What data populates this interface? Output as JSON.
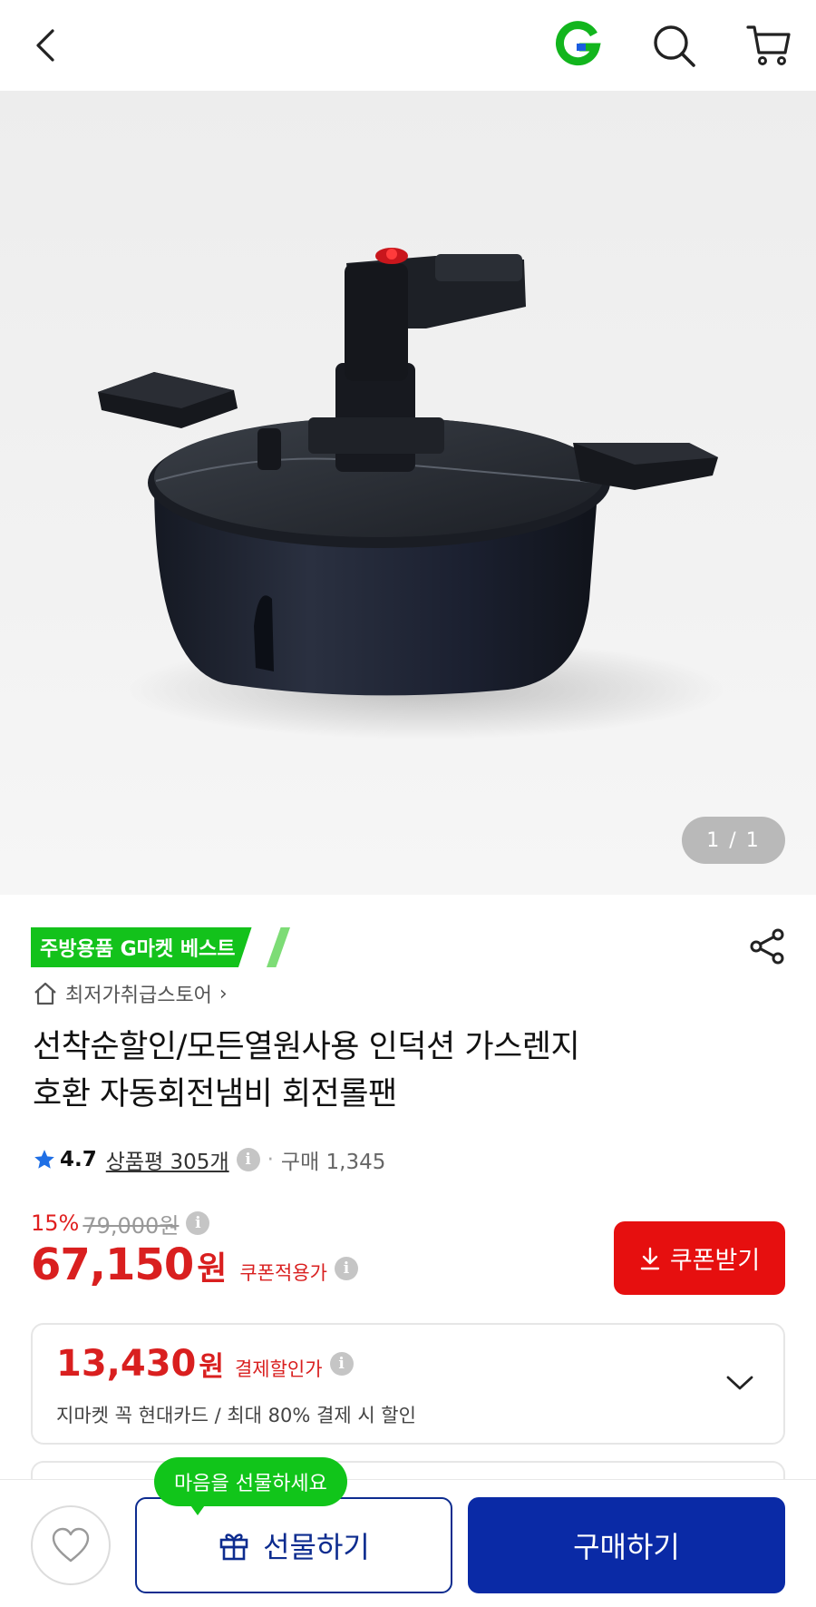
{
  "header": {
    "back_icon": "chevron-left-icon",
    "logo_letter": "G",
    "logo_color": "#12b51d",
    "search_icon": "search-icon",
    "cart_icon": "cart-icon"
  },
  "gallery": {
    "counter": "1 / 1"
  },
  "product": {
    "badge": "주방용품 G마켓 베스트",
    "badge_color": "#13c21b",
    "store_name": "최저가취급스토어",
    "title_line1": "선착순할인/모든열원사용 인덕션 가스렌지",
    "title_line2": "호환 자동회전냄비 회전롤팬",
    "rating": "4.7",
    "reviews_label": "상품평 305개",
    "purchase_label": "구매 1,345",
    "discount_pct": "15%",
    "original_price": "79,000원",
    "price": "67,150",
    "price_unit": "원",
    "price_label": "쿠폰적용가",
    "coupon_button": "쿠폰받기",
    "accent_red": "#e60f0f"
  },
  "payment_discount": {
    "price": "13,430",
    "unit": "원",
    "label": "결제할인가",
    "description": "지마켓 꼭 현대카드 / 최대 80% 결제 시 할인"
  },
  "bottom_bar": {
    "gift_tooltip": "마음을 선물하세요",
    "gift_button": "선물하기",
    "buy_button": "구매하기",
    "buy_color": "#0a2aa6"
  }
}
